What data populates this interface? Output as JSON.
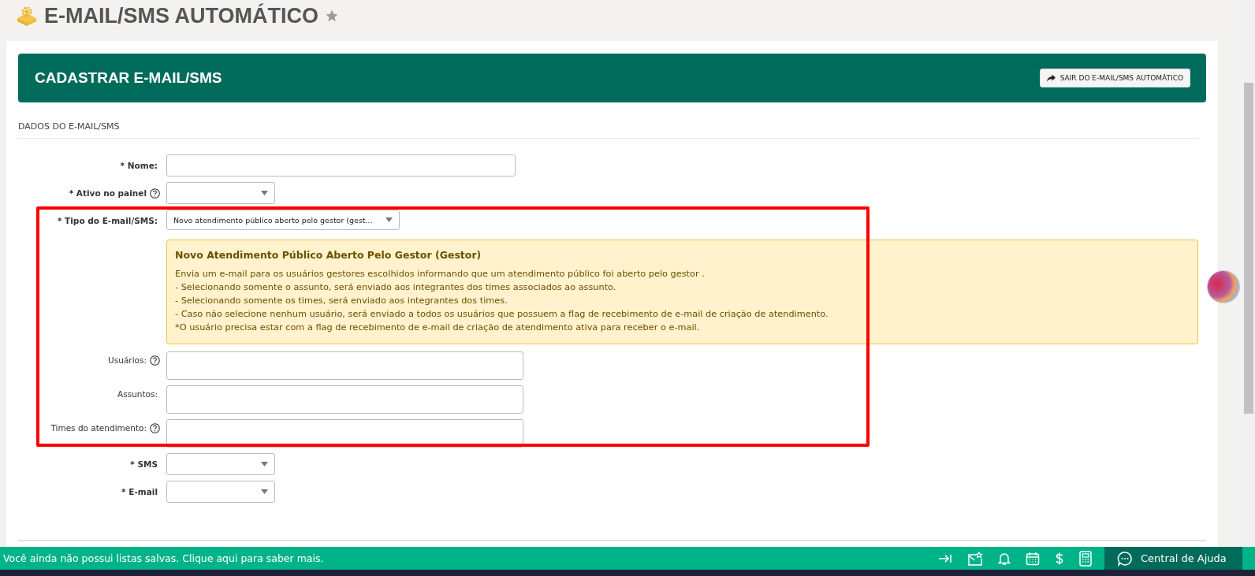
{
  "page": {
    "title": "E-MAIL/SMS AUTOMÁTICO",
    "favorite": false
  },
  "banner": {
    "title": "CADASTRAR E-MAIL/SMS",
    "exit_button": "SAIR DO E-MAIL/SMS AUTOMÁTICO"
  },
  "section": {
    "title": "DADOS DO E-MAIL/SMS"
  },
  "fields": [
    {
      "label": "* Nome:",
      "help": false,
      "kind": "text",
      "bold": true
    },
    {
      "label": "* Ativo no painel",
      "help": true,
      "kind": "select",
      "bold": true
    },
    {
      "label": "* Tipo do E-mail/SMS:",
      "help": false,
      "kind": "select-wide",
      "bold": true,
      "value": "Novo atendimento público aberto pelo gestor (gest...",
      "info": {
        "title": "Novo Atendimento Público Aberto Pelo Gestor (Gestor)",
        "lines": [
          "Envia um e-mail para os usuários gestores escolhidos informando que um atendimento público foi aberto pelo gestor .",
          "- Selecionando somente o assunto, será enviado aos integrantes dos times associados ao assunto.",
          "- Selecionando somente os times, será enviado aos integrantes dos times.",
          "- Caso não selecione nenhum usuário, será enviado a todos os usuários que possuem a flag de recebimento de e-mail de criação de atendimento.",
          "*O usuário precisa estar com a flag de recebimento de e-mail de criação de atendimento ativa para receber o e-mail."
        ]
      }
    },
    {
      "label": "Usuários:",
      "help": true,
      "kind": "multi",
      "bold": false
    },
    {
      "label": "Assuntos:",
      "help": false,
      "kind": "multi",
      "bold": false
    },
    {
      "label": "Times do atendimento:",
      "help": true,
      "kind": "multi",
      "bold": false
    },
    {
      "label": "* SMS",
      "help": false,
      "kind": "select",
      "bold": true
    },
    {
      "label": "* E-mail",
      "help": false,
      "kind": "select",
      "bold": true
    }
  ],
  "bottom_bar": {
    "message": "Você ainda não possui listas salvas. Clique aqui para saber mais.",
    "help_center": "Central de Ajuda"
  }
}
